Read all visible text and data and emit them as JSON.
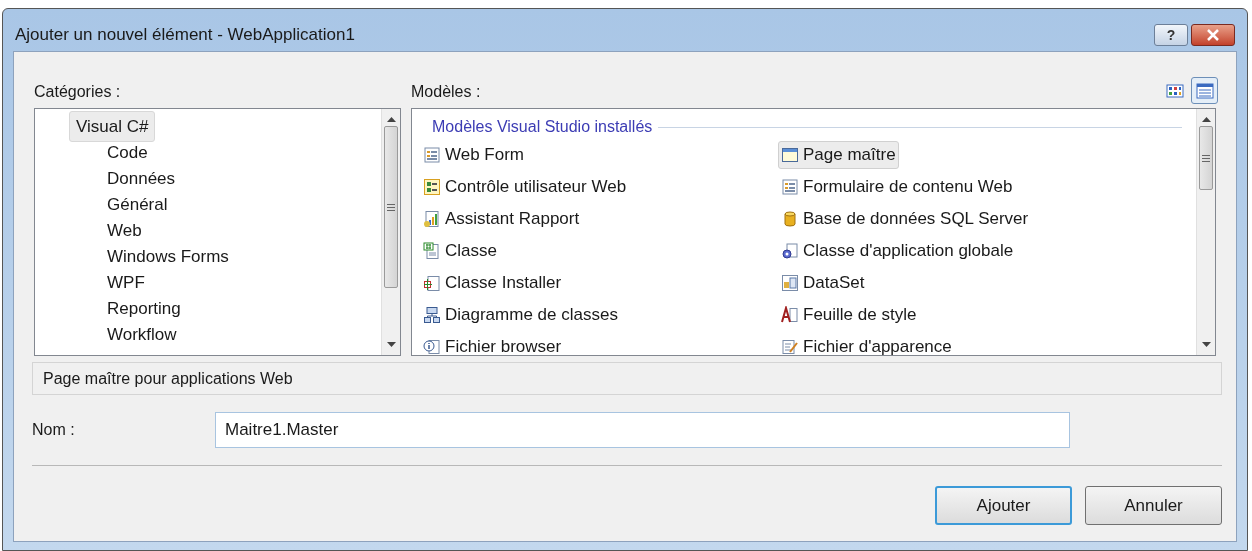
{
  "window": {
    "title": "Ajouter un nouvel élément - WebApplication1",
    "help_button": "?"
  },
  "view_buttons": [
    {
      "kind": "icons",
      "selected": false
    },
    {
      "kind": "list",
      "selected": true
    }
  ],
  "categories": {
    "label": "Catégories :",
    "items": [
      {
        "label": "Visual C#",
        "selected": true,
        "children": [
          {
            "label": "Code",
            "selected": false
          },
          {
            "label": "Données",
            "selected": false
          },
          {
            "label": "Général",
            "selected": false
          },
          {
            "label": "Web",
            "selected": false
          },
          {
            "label": "Windows Forms",
            "selected": false
          },
          {
            "label": "WPF",
            "selected": false
          },
          {
            "label": "Reporting",
            "selected": false
          },
          {
            "label": "Workflow",
            "selected": false
          }
        ]
      }
    ]
  },
  "templates": {
    "label": "Modèles :",
    "group": "Modèles Visual Studio installés",
    "items": [
      {
        "label": "Web Form",
        "kind": "form",
        "selected": false
      },
      {
        "label": "Page maître",
        "kind": "master",
        "selected": true
      },
      {
        "label": "Contrôle utilisateur Web",
        "kind": "control",
        "selected": false
      },
      {
        "label": "Formulaire de contenu Web",
        "kind": "form",
        "selected": false
      },
      {
        "label": "Assistant Rapport",
        "kind": "report",
        "selected": false
      },
      {
        "label": "Base de données SQL Server",
        "kind": "database",
        "selected": false
      },
      {
        "label": "Classe",
        "kind": "class",
        "selected": false
      },
      {
        "label": "Classe d'application globale",
        "kind": "global",
        "selected": false
      },
      {
        "label": "Classe Installer",
        "kind": "installer",
        "selected": false
      },
      {
        "label": "DataSet",
        "kind": "dataset",
        "selected": false
      },
      {
        "label": "Diagramme de classes",
        "kind": "diagram",
        "selected": false
      },
      {
        "label": "Feuille de style",
        "kind": "style",
        "selected": false
      },
      {
        "label": "Fichier browser",
        "kind": "info",
        "selected": false
      },
      {
        "label": "Fichier d'apparence",
        "kind": "skin",
        "selected": false
      }
    ]
  },
  "description": "Page maître pour applications Web",
  "name_field": {
    "label": "Nom :",
    "value": "Maitre1.Master"
  },
  "buttons": [
    {
      "label": "Ajouter",
      "kind": "default"
    },
    {
      "label": "Annuler",
      "kind": "normal"
    }
  ]
}
